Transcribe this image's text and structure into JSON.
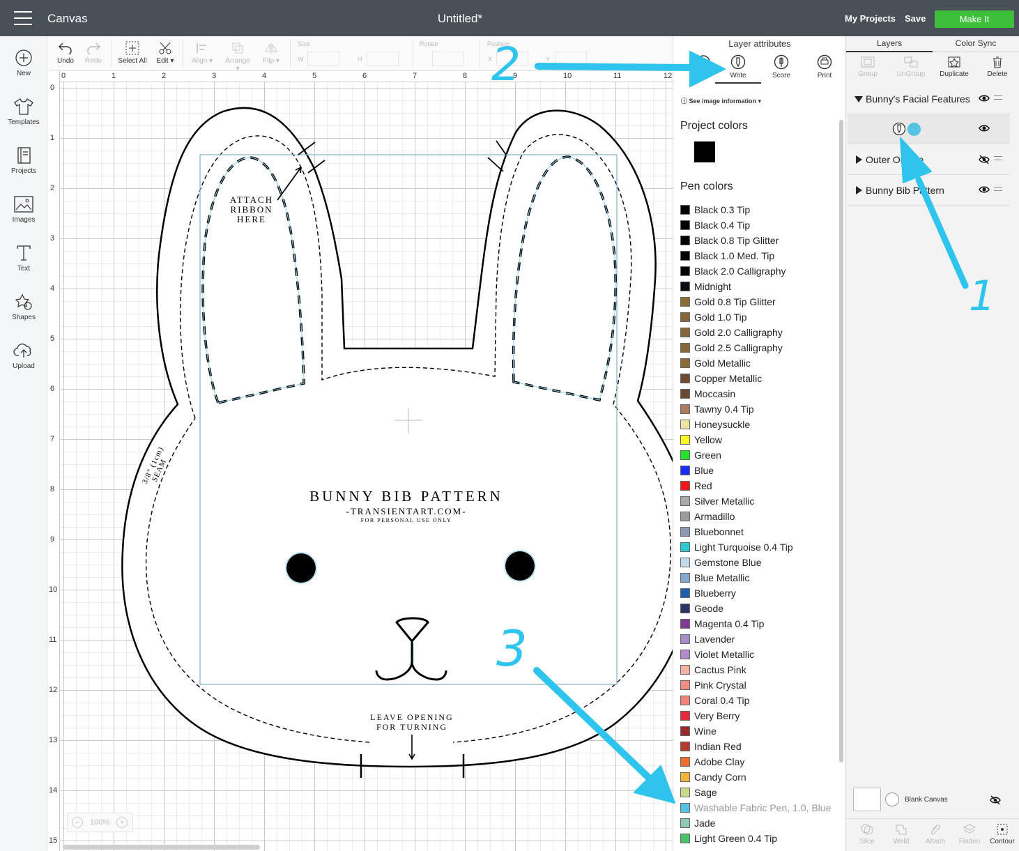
{
  "topbar": {
    "app_title": "Canvas",
    "document_title": "Untitled*",
    "my_projects": "My Projects",
    "save": "Save",
    "make_it": "Make It"
  },
  "leftnav": [
    {
      "label": "New",
      "icon": "plus-circle-icon"
    },
    {
      "label": "Templates",
      "icon": "shirt-icon"
    },
    {
      "label": "Projects",
      "icon": "projects-icon"
    },
    {
      "label": "Images",
      "icon": "image-icon"
    },
    {
      "label": "Text",
      "icon": "text-icon"
    },
    {
      "label": "Shapes",
      "icon": "shapes-icon"
    },
    {
      "label": "Upload",
      "icon": "upload-icon"
    }
  ],
  "toolbar": {
    "undo": "Undo",
    "redo": "Redo",
    "select_all": "Select All",
    "edit": "Edit",
    "align": "Align",
    "arrange": "Arrange",
    "flip": "Flip",
    "size": "Size",
    "w": "W",
    "h": "H",
    "rotate": "Rotate",
    "position": "Position",
    "x": "X",
    "y": "Y"
  },
  "rulers": {
    "top": [
      "0",
      "1",
      "2",
      "3",
      "4",
      "5",
      "6",
      "7",
      "8",
      "9",
      "10",
      "11",
      "12"
    ],
    "left": [
      "0",
      "1",
      "2",
      "3",
      "4",
      "5",
      "6",
      "7",
      "8",
      "9",
      "10",
      "11",
      "12",
      "13",
      "14",
      "15"
    ]
  },
  "artwork": {
    "attach_ribbon": [
      "ATTACH",
      "RIBBON",
      "HERE"
    ],
    "title": "BUNNY BIB PATTERN",
    "site": "-TRANSIENTART.COM-",
    "personal": "FOR PERSONAL USE ONLY",
    "seam_a": "3/8\" (1cm)",
    "seam_b": "SEAM",
    "leave_opening": "LEAVE OPENING",
    "for_turning": "FOR TURNING"
  },
  "zoom": "100%",
  "attributes": {
    "title": "Layer attributes",
    "write": "Write",
    "score": "Score",
    "print": "Print",
    "see_info": "See image information",
    "project_colors": "Project colors",
    "project_color": "#000000",
    "pen_colors": "Pen colors",
    "pens": [
      {
        "name": "Black 0.3 Tip",
        "color": "#000000"
      },
      {
        "name": "Black 0.4 Tip",
        "color": "#000000"
      },
      {
        "name": "Black 0.8 Tip Glitter",
        "color": "#000000"
      },
      {
        "name": "Black 1.0 Med. Tip",
        "color": "#000000"
      },
      {
        "name": "Black 2.0 Calligraphy",
        "color": "#000000"
      },
      {
        "name": "Midnight",
        "color": "#0b0b12"
      },
      {
        "name": "Gold 0.8 Tip Glitter",
        "color": "#8a6c35"
      },
      {
        "name": "Gold 1.0 Tip",
        "color": "#86683a"
      },
      {
        "name": "Gold 2.0 Calligraphy",
        "color": "#86683a"
      },
      {
        "name": "Gold 2.5 Calligraphy",
        "color": "#86683a"
      },
      {
        "name": "Gold Metallic",
        "color": "#8a6b3b"
      },
      {
        "name": "Copper Metallic",
        "color": "#6e4b32"
      },
      {
        "name": "Moccasin",
        "color": "#6a4a33"
      },
      {
        "name": "Tawny 0.4 Tip",
        "color": "#a77b5b"
      },
      {
        "name": "Honeysuckle",
        "color": "#efe3a4"
      },
      {
        "name": "Yellow",
        "color": "#fbfb1f"
      },
      {
        "name": "Green",
        "color": "#22e229"
      },
      {
        "name": "Blue",
        "color": "#1a2cf5"
      },
      {
        "name": "Red",
        "color": "#f41515"
      },
      {
        "name": "Silver Metallic",
        "color": "#a9a9a9"
      },
      {
        "name": "Armadillo",
        "color": "#9b9b9b"
      },
      {
        "name": "Bluebonnet",
        "color": "#8d9bb2"
      },
      {
        "name": "Light Turquoise 0.4 Tip",
        "color": "#2cc9cf"
      },
      {
        "name": "Gemstone Blue",
        "color": "#c3dbe8"
      },
      {
        "name": "Blue Metallic",
        "color": "#86a6cf"
      },
      {
        "name": "Blueberry",
        "color": "#1f5ea8"
      },
      {
        "name": "Geode",
        "color": "#2b3463"
      },
      {
        "name": "Magenta 0.4 Tip",
        "color": "#7c3a92"
      },
      {
        "name": "Lavender",
        "color": "#a48cc4"
      },
      {
        "name": "Violet Metallic",
        "color": "#b08ac9"
      },
      {
        "name": "Cactus Pink",
        "color": "#f5b1a3"
      },
      {
        "name": "Pink Crystal",
        "color": "#f38d83"
      },
      {
        "name": "Coral 0.4 Tip",
        "color": "#f2827c"
      },
      {
        "name": "Very Berry",
        "color": "#e8293d"
      },
      {
        "name": "Wine",
        "color": "#9b2a2f"
      },
      {
        "name": "Indian Red",
        "color": "#b63a2e"
      },
      {
        "name": "Adobe Clay",
        "color": "#ef6e2c"
      },
      {
        "name": "Candy Corn",
        "color": "#f4b43a"
      },
      {
        "name": "Sage",
        "color": "#c9d98a"
      },
      {
        "name": "Washable Fabric Pen, 1.0, Blue",
        "color": "#55c3e4"
      },
      {
        "name": "Jade",
        "color": "#8fcab0"
      },
      {
        "name": "Light Green 0.4 Tip",
        "color": "#4cc16a"
      }
    ]
  },
  "layers_panel": {
    "tab_layers": "Layers",
    "tab_color_sync": "Color Sync",
    "group": "Group",
    "ungroup": "UnGroup",
    "duplicate": "Duplicate",
    "delete": "Delete",
    "layers": [
      {
        "name": "Bunny's Facial Features",
        "expanded": true,
        "visible": true
      },
      {
        "name": "Outer Outline",
        "expanded": false,
        "visible": false
      },
      {
        "name": "Bunny Bib Pattern",
        "expanded": false,
        "visible": true
      }
    ],
    "sublayer_color": "#55c3e4",
    "blank_canvas": "Blank Canvas",
    "slice": "Slice",
    "weld": "Weld",
    "attach": "Attach",
    "flatten": "Flatten",
    "contour": "Contour"
  },
  "annotations": {
    "color": "#2fc4ee",
    "one": "1",
    "two": "2",
    "three": "3"
  }
}
